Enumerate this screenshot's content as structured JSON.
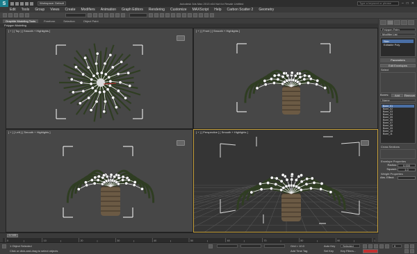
{
  "app": {
    "logo_letter": "S",
    "workspace": "Workspace: Default",
    "title": "Autodesk 3ds Max 2013 x64   Not for Resale   Untitled",
    "search_placeholder": "Type a keyword or phrase",
    "window_controls": [
      "–",
      "□",
      "✕"
    ]
  },
  "menu": [
    "Edit",
    "Tools",
    "Group",
    "Views",
    "Create",
    "Modifiers",
    "Animation",
    "Graph Editors",
    "Rendering",
    "Customize",
    "MAXScript",
    "Help",
    "Carbon Scatter 2",
    "Geometry"
  ],
  "ribbon": {
    "tabs": [
      "Graphite Modeling Tools",
      "Freeform",
      "Selection",
      "Object Paint"
    ],
    "active_tab": 0,
    "subtitle": "Polygon Modeling"
  },
  "viewports": {
    "top": "[ + ] [ Top ] [ Smooth + Highlights ]",
    "front": "[ + ] [ Front ] [ Smooth + Highlights ]",
    "left": "[ + ] [ Left ] [ Smooth + Highlights ]",
    "perspective": "[ + ] [ Perspective ] [ Smooth + Highlights ]"
  },
  "command_panel": {
    "object_name": "Polygon Palm",
    "modifier_list": "Modifier List",
    "stack": [
      "Skin",
      "Editable Poly"
    ],
    "parameters_title": "Parameters",
    "edit_envelopes": "Edit Envelopes",
    "select_label": "Select",
    "bones_label": "Bones:",
    "bones_add": "Add",
    "bones_remove": "Remove",
    "name_header": "Name",
    "bones": [
      "Bone_01",
      "Bone_02",
      "Bone_03",
      "Bone_04",
      "Bone_05",
      "Bone_06",
      "Bone_07",
      "Bone_08",
      "Bone_09",
      "Bone_10",
      "Bone_11"
    ],
    "cross_sections": "Cross Sections",
    "envelope_properties": "Envelope Properties",
    "radius_label": "Radius:",
    "radius_value": "0.000",
    "squash_label": "Squash:",
    "squash_value": "1.0",
    "weight_properties": "Weight Properties",
    "abs_effect_label": "Abs. Effect:"
  },
  "timeline": {
    "slider": "0 / 100",
    "ticks": [
      "0",
      "10",
      "20",
      "30",
      "40",
      "50",
      "60",
      "70",
      "80",
      "90",
      "100"
    ]
  },
  "status": {
    "selection": "1 Object Selected",
    "prompt": "Click or click-and-drag to select objects",
    "grid": "Grid = 10.0",
    "add_time_tag": "Add Time Tag",
    "auto_key": "Auto Key",
    "set_key": "Set Key",
    "selected": "Selected",
    "key_filters": "Key Filters...",
    "frame": "0"
  },
  "colors": {
    "viewport_bg": "#474747",
    "active_border": "#c9a23a",
    "selection_highlight": "#4a6fa5",
    "autokey_red": "#c03030"
  }
}
